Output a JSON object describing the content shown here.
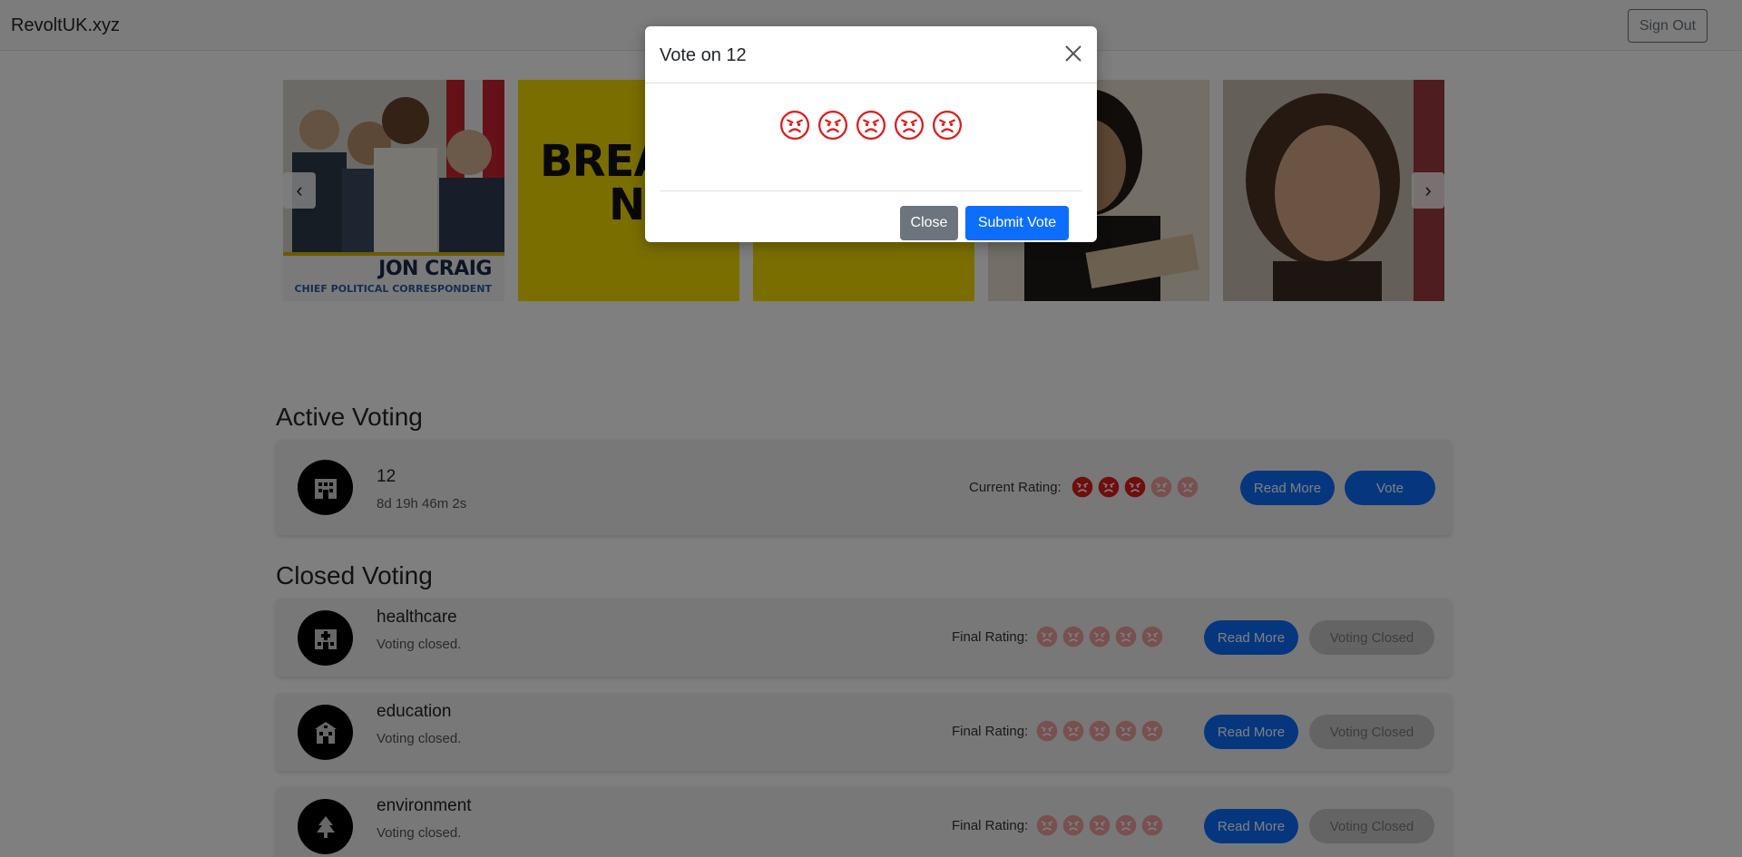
{
  "navbar": {
    "brand": "RevoltUK.xyz",
    "signout_label": "Sign Out"
  },
  "carousel": {
    "slides": [
      {
        "caption_name": "JON CRAIG",
        "caption_role": "CHIEF POLITICAL CORRESPONDENT"
      },
      {
        "text_line1": "BREAK",
        "text_line2": "NEW"
      },
      {},
      {},
      {}
    ],
    "prev_icon": "chevron-left-icon",
    "next_icon": "chevron-right-icon"
  },
  "active": {
    "title": "Active Voting",
    "items": [
      {
        "name": "12",
        "timer": "8d 19h 46m 2s",
        "rating_label": "Current Rating:",
        "rating": 3,
        "read_more": "Read More",
        "vote": "Vote",
        "icon": "building-icon"
      }
    ]
  },
  "closed": {
    "title": "Closed Voting",
    "items": [
      {
        "name": "healthcare",
        "status": "Voting closed.",
        "rating_label": "Final Rating:",
        "rating": 0,
        "read_more": "Read More",
        "closed_label": "Voting Closed",
        "icon": "hospital-icon"
      },
      {
        "name": "education",
        "status": "Voting closed.",
        "rating_label": "Final Rating:",
        "rating": 0,
        "read_more": "Read More",
        "closed_label": "Voting Closed",
        "icon": "school-icon"
      },
      {
        "name": "environment",
        "status": "Voting closed.",
        "rating_label": "Final Rating:",
        "rating": 0,
        "read_more": "Read More",
        "closed_label": "Voting Closed",
        "icon": "tree-icon"
      }
    ]
  },
  "modal": {
    "title": "Vote on 12",
    "star_count": 5,
    "close_label": "Close",
    "submit_label": "Submit Vote"
  },
  "colors": {
    "primary": "#0d6efd",
    "secondary": "#6c757d",
    "angry_red": "#e01b1b",
    "angry_faded": "#f0a0a0"
  }
}
